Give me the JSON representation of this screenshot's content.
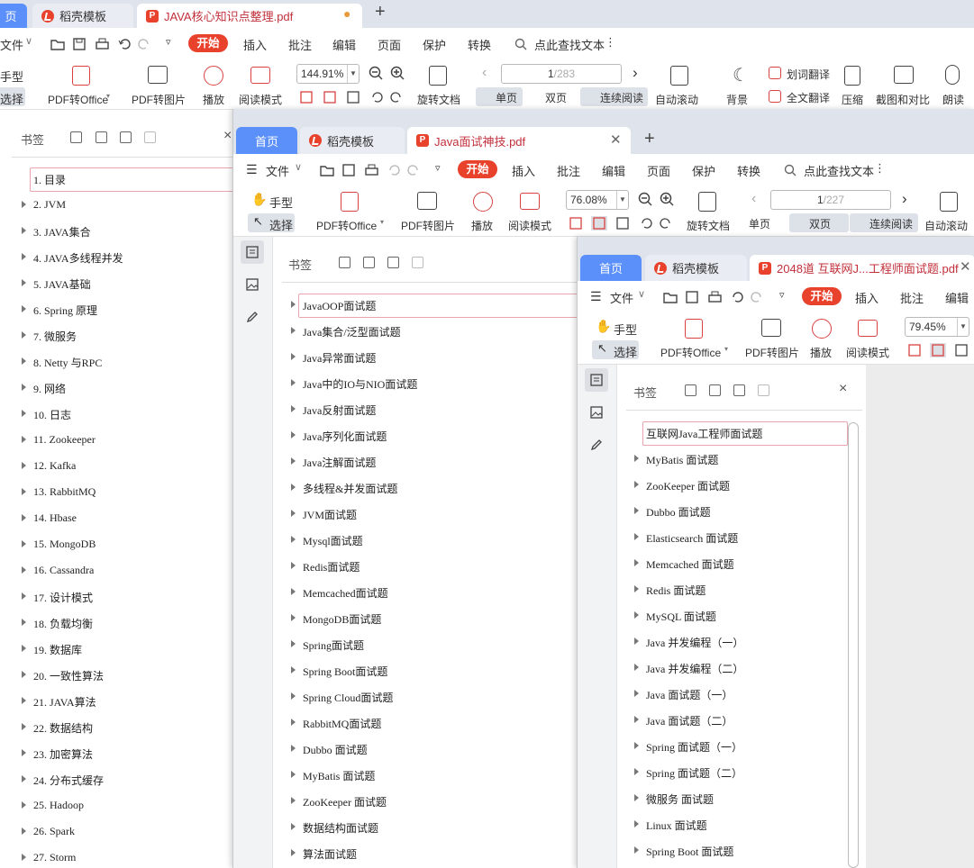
{
  "w1": {
    "tabs": [
      {
        "label": "页"
      },
      {
        "label": "稻壳模板"
      },
      {
        "label": "JAVA核心知识点整理.pdf"
      }
    ],
    "tab_plus": "+",
    "menu": [
      {
        "label": "文件"
      },
      {
        "label": "插入"
      },
      {
        "label": "批注"
      },
      {
        "label": "编辑"
      },
      {
        "label": "页面"
      },
      {
        "label": "保护"
      },
      {
        "label": "转换"
      },
      {
        "label": "点此查找文本"
      }
    ],
    "start": "开始",
    "tools": {
      "hand": "手型",
      "select": "选择",
      "pdf_office": "PDF转Office",
      "pdf_img": "PDF转图片",
      "play": "播放",
      "read": "阅读模式",
      "rotate": "旋转文档",
      "single": "单页",
      "double": "双页",
      "continuous": "连续阅读",
      "autoscroll": "自动滚动",
      "bg": "背景",
      "word_trans": "划词翻译",
      "full_trans": "全文翻译",
      "compress": "压缩",
      "compare": "截图和对比",
      "speak": "朗读"
    },
    "zoom": "144.91%",
    "page": {
      "cur": "1",
      "total": "/283"
    },
    "bookmark_title": "书签",
    "bookmarks": [
      "1. 目录",
      "2. JVM",
      "3. JAVA集合",
      "4. JAVA多线程并发",
      "5. JAVA基础",
      "6. Spring 原理",
      "7.  微服务",
      "8. Netty 与RPC",
      "9. 网络",
      "10. 日志",
      "11. Zookeeper",
      "12. Kafka",
      "13. RabbitMQ",
      "14. Hbase",
      "15. MongoDB",
      "16. Cassandra",
      "17. 设计模式",
      "18. 负载均衡",
      "19. 数据库",
      "20. 一致性算法",
      "21. JAVA算法",
      "22. 数据结构",
      "23. 加密算法",
      "24. 分布式缓存",
      "25. Hadoop",
      "26. Spark",
      "27. Storm"
    ]
  },
  "w2": {
    "tabs": [
      {
        "label": "首页"
      },
      {
        "label": "稻壳模板"
      },
      {
        "label": "Java面试神技.pdf"
      }
    ],
    "tab_plus": "+",
    "menu": [
      {
        "label": "文件"
      },
      {
        "label": "插入"
      },
      {
        "label": "批注"
      },
      {
        "label": "编辑"
      },
      {
        "label": "页面"
      },
      {
        "label": "保护"
      },
      {
        "label": "转换"
      },
      {
        "label": "点此查找文本"
      }
    ],
    "start": "开始",
    "tools": {
      "hand": "手型",
      "select": "选择",
      "pdf_office": "PDF转Office",
      "pdf_img": "PDF转图片",
      "play": "播放",
      "read": "阅读模式",
      "rotate": "旋转文档",
      "single": "单页",
      "double": "双页",
      "continuous": "连续阅读",
      "autoscroll": "自动滚动"
    },
    "zoom": "76.08%",
    "page": {
      "cur": "1",
      "total": "/227"
    },
    "bookmark_title": "书签",
    "bookmarks": [
      "JavaOOP面试题",
      "Java集合/泛型面试题",
      "Java异常面试题",
      "Java中的IO与NIO面试题",
      "Java反射面试题",
      "Java序列化面试题",
      "Java注解面试题",
      "多线程&并发面试题",
      "JVM面试题",
      "Mysql面试题",
      "Redis面试题",
      "Memcached面试题",
      "MongoDB面试题",
      "Spring面试题",
      "Spring Boot面试题",
      "Spring Cloud面试题",
      "RabbitMQ面试题",
      "Dubbo 面试题",
      "MyBatis 面试题",
      "ZooKeeper 面试题",
      "数据结构面试题",
      "算法面试题"
    ]
  },
  "w3": {
    "tabs": [
      {
        "label": "首页"
      },
      {
        "label": "稻壳模板"
      },
      {
        "label": "2048道 互联网J...工程师面试题.pdf"
      }
    ],
    "menu": [
      {
        "label": "文件"
      },
      {
        "label": "插入"
      },
      {
        "label": "批注"
      },
      {
        "label": "编辑"
      }
    ],
    "start": "开始",
    "tools": {
      "hand": "手型",
      "select": "选择",
      "pdf_office": "PDF转Office",
      "pdf_img": "PDF转图片",
      "play": "播放",
      "read": "阅读模式"
    },
    "zoom": "79.45%",
    "bookmark_title": "书签",
    "bookmarks": [
      "互联网Java工程师面试题",
      "MyBatis 面试题",
      "ZooKeeper 面试题",
      "Dubbo 面试题",
      "Elasticsearch 面试题",
      "Memcached 面试题",
      "Redis 面试题",
      "MySQL 面试题",
      "Java 并发编程（一）",
      "Java 并发编程（二）",
      "Java 面试题（一）",
      "Java 面试题（二）",
      "Spring 面试题（一）",
      "Spring 面试题（二）",
      "微服务 面试题",
      "Linux 面试题",
      "Spring Boot 面试题"
    ]
  },
  "colors": {
    "accent": "#e8412c",
    "home_tab": "#5b8ff9",
    "tabbar": "#dee3ec",
    "selected_outline": "#e9a6ac"
  }
}
